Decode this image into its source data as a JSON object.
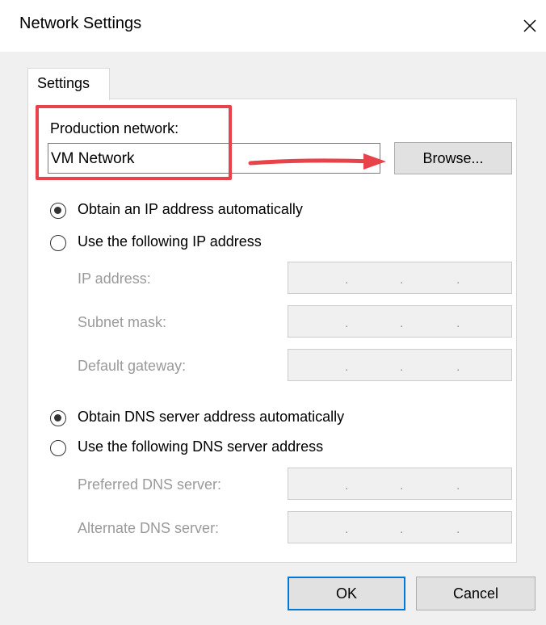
{
  "window": {
    "title": "Network Settings",
    "close_icon": "close-icon"
  },
  "tab": {
    "label": "Settings"
  },
  "production": {
    "label": "Production network:",
    "value": "VM Network",
    "browse_label": "Browse..."
  },
  "ip": {
    "auto_label": "Obtain an IP address automatically",
    "manual_label": "Use the following IP address",
    "selected": "auto",
    "fields": [
      {
        "label": "IP address:"
      },
      {
        "label": "Subnet mask:"
      },
      {
        "label": "Default gateway:"
      }
    ]
  },
  "dns": {
    "auto_label": "Obtain DNS server address automatically",
    "manual_label": "Use the following DNS server address",
    "selected": "auto",
    "fields": [
      {
        "label": "Preferred DNS server:"
      },
      {
        "label": "Alternate DNS server:"
      }
    ]
  },
  "ip_dot": ".",
  "footer": {
    "ok_label": "OK",
    "cancel_label": "Cancel"
  },
  "annotation": {
    "color": "#e8434a"
  }
}
